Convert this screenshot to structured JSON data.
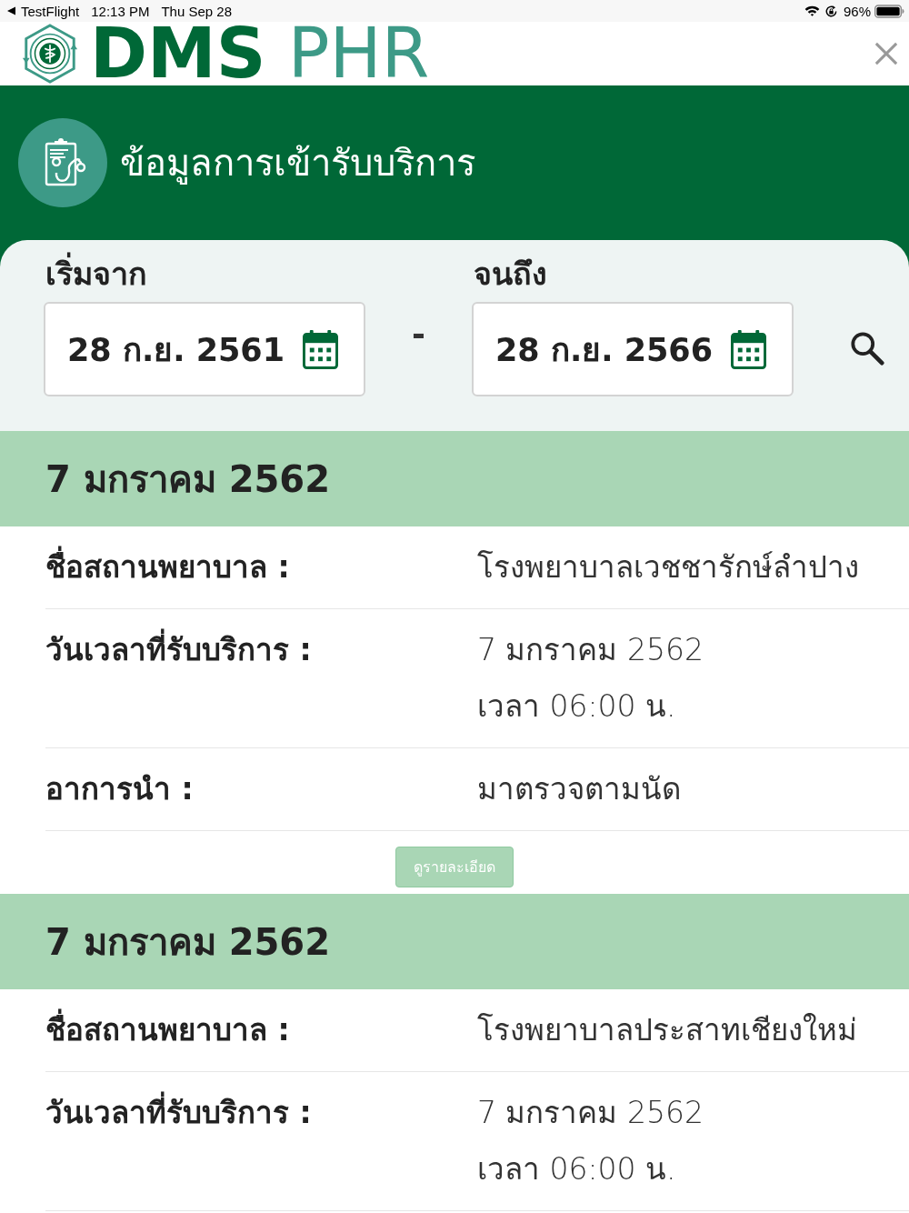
{
  "status_bar": {
    "back_label": "TestFlight",
    "time": "12:13 PM",
    "date": "Thu Sep 28",
    "battery": "96%"
  },
  "header": {
    "logo_primary": "DMS",
    "logo_secondary": "PHR"
  },
  "banner": {
    "title": "ข้อมูลการเข้ารับบริการ"
  },
  "date_filter": {
    "from": {
      "label": "เริ่มจาก",
      "value": "28 ก.ย. 2561"
    },
    "separator": "-",
    "to": {
      "label": "จนถึง",
      "value": "28 ก.ย. 2566"
    }
  },
  "records": [
    {
      "date": "7 มกราคม 2562",
      "fields": [
        {
          "label": "ชื่อสถานพยาบาล :",
          "lines": [
            "โรงพยาบาลเวชชารักษ์ลำปาง"
          ]
        },
        {
          "label": "วันเวลาที่รับบริการ :",
          "lines": [
            "7 มกราคม 2562",
            "เวลา 06:00 น."
          ]
        },
        {
          "label": "อาการนำ :",
          "lines": [
            "มาตรวจตามนัด"
          ]
        }
      ],
      "details_button": "ดูรายละเอียด"
    },
    {
      "date": "7 มกราคม 2562",
      "fields": [
        {
          "label": "ชื่อสถานพยาบาล :",
          "lines": [
            "โรงพยาบาลประสาทเชียงใหม่"
          ]
        },
        {
          "label": "วันเวลาที่รับบริการ :",
          "lines": [
            "7 มกราคม 2562",
            "เวลา 06:00 น."
          ]
        }
      ]
    }
  ]
}
